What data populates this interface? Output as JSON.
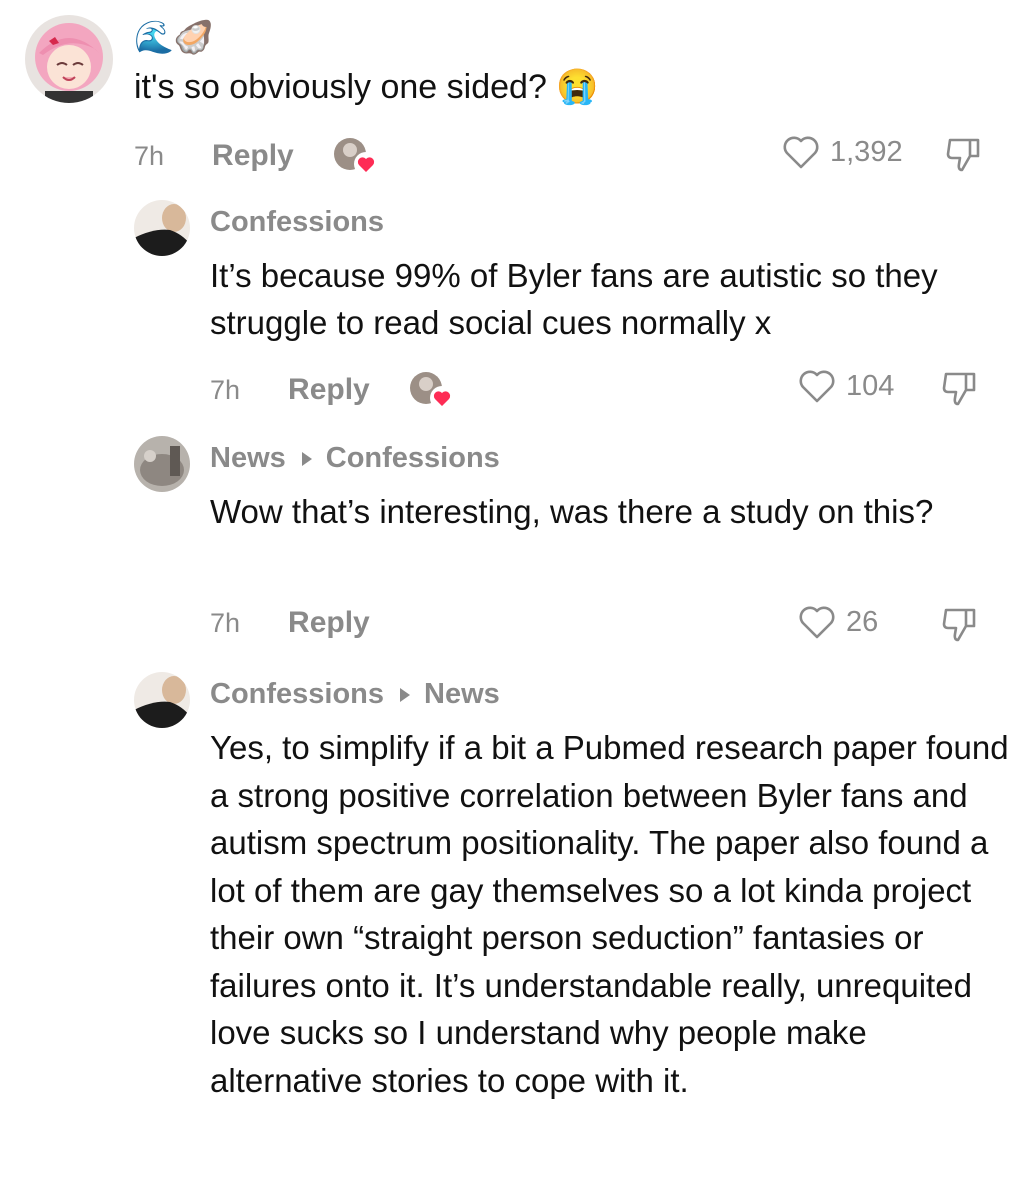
{
  "comments": [
    {
      "author_emoji": "🌊🦪",
      "text": "it's so obviously one sided? 😭",
      "time": "7h",
      "reply_label": "Reply",
      "likes": "1,392"
    },
    {
      "author": "Confessions",
      "text": "It’s because 99% of Byler fans are autistic so they struggle to read social cues normally x",
      "time": "7h",
      "reply_label": "Reply",
      "likes": "104"
    },
    {
      "author": "News",
      "reply_to": "Confessions",
      "text": "Wow that’s interesting, was there a study on this?",
      "time": "7h",
      "reply_label": "Reply",
      "likes": "26"
    },
    {
      "author": "Confessions",
      "reply_to": "News",
      "text": "Yes, to simplify if a bit a Pubmed research paper found a strong positive correlation between Byler fans and autism spectrum positionality. The paper also found a lot of them are gay themselves so a lot kinda project their own “straight person seduction” fantasies or failures onto it. It’s understandable really, unrequited love sucks so I understand why people make alternative stories to cope with it."
    }
  ],
  "colors": {
    "text": "#111111",
    "meta": "#8a8a8a",
    "creator_heart": "#fe2c55",
    "avatar_hair": "#f3a6c0"
  },
  "icons": [
    "heart-outline-icon",
    "dislike-icon",
    "creator-liked-heart-icon",
    "reply-arrow-icon"
  ]
}
